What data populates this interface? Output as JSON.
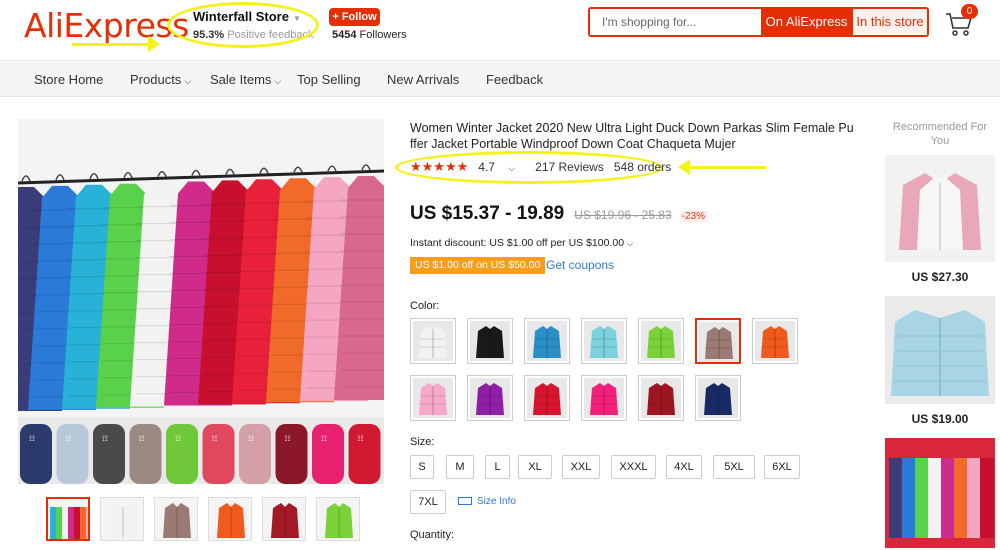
{
  "header": {
    "logo": "AliExpress",
    "store_name": "Winterfall Store",
    "feedback_pct": "95.3%",
    "feedback_label": "Positive feedback",
    "follow_label": "+ Follow",
    "followers_count": "5454",
    "followers_label": "Followers",
    "search_placeholder": "I'm shopping for...",
    "search_ali": "On AliExpress",
    "search_store": "In this store",
    "cart_count": "0"
  },
  "nav": {
    "items": [
      "Store Home",
      "Products",
      "Sale Items",
      "Top Selling",
      "New Arrivals",
      "Feedback"
    ]
  },
  "product": {
    "title": "Women Winter Jacket 2020 New Ultra Light Duck Down Parkas Slim Female Puffer Jacket Portable Windproof Down Coat Chaqueta Mujer",
    "rating": "4.7",
    "reviews": "217 Reviews",
    "orders": "548 orders",
    "price": "US $15.37 - 19.89",
    "original_price": "US $19.96 - 25.83",
    "discount": "-23%",
    "instant_discount": "Instant discount: US $1.00 off per US $100.00",
    "coupon_tag": "US $1.00 off on US $50.00",
    "get_coupons": "Get coupons",
    "color_label": "Color:",
    "colors": [
      "#f2f2f2",
      "#1a1a1a",
      "#2a8fc4",
      "#7ad0dc",
      "#7bd13a",
      "#9a7a72",
      "#f05a1c",
      "#f6a9c8",
      "#8e1fa6",
      "#d7142d",
      "#f2207a",
      "#9e1522",
      "#1a2a66"
    ],
    "selected_color_index": 5,
    "size_label": "Size:",
    "sizes": [
      "S",
      "M",
      "L",
      "XL",
      "XXL",
      "XXXL",
      "4XL",
      "5XL",
      "6XL",
      "7XL"
    ],
    "size_info": "Size Info",
    "quantity_label": "Quantity:"
  },
  "gallery": {
    "jacket_colors": [
      "#3a3d7a",
      "#2a7ad8",
      "#28b2d8",
      "#5ad14a",
      "#f2f2f0",
      "#d02a8a",
      "#c8102e",
      "#e8203a",
      "#f06a2a",
      "#f4a6c2",
      "#d9688e"
    ],
    "bag_colors": [
      "#2a3a6a",
      "#b9c8d8",
      "#4a4a4a",
      "#9a8a82",
      "#6ec83a",
      "#e04860",
      "#d4a0a8",
      "#8a1828",
      "#e82070",
      "#d01830"
    ],
    "thumbs": [
      "#e05a9a",
      "#f2f2f2",
      "#9a7a72",
      "#f05a1c",
      "#a21a26",
      "#7bd13a"
    ]
  },
  "recommended": {
    "title": "Recommended For You",
    "items": [
      {
        "price": "US $27.30",
        "color": "#e8a8b8"
      },
      {
        "price": "US $19.00",
        "color": "#a8d4e4"
      }
    ]
  }
}
